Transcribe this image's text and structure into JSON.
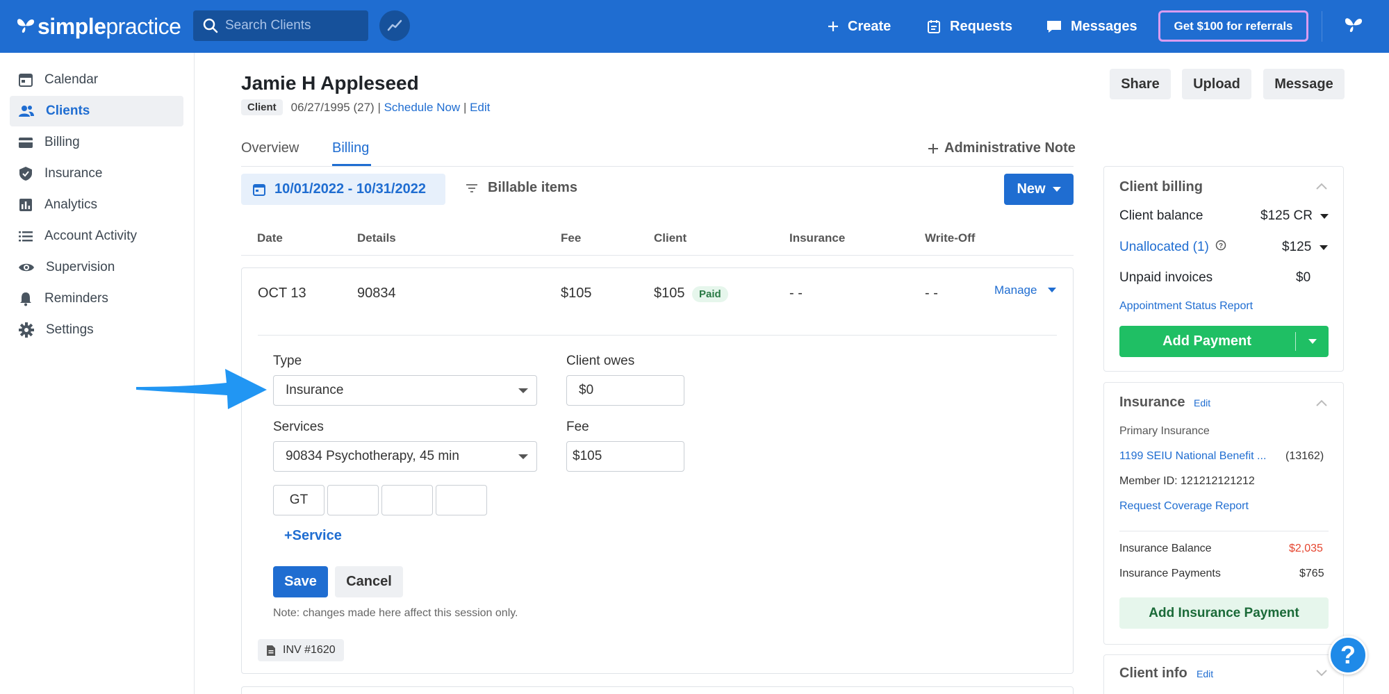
{
  "app": {
    "logo_bold": "simple",
    "logo_light": "practice",
    "search_placeholder": "Search Clients",
    "create": "Create",
    "requests": "Requests",
    "messages": "Messages",
    "referral": "Get $100 for referrals"
  },
  "sidebar": {
    "items": [
      {
        "label": "Calendar",
        "icon": "calendar-icon"
      },
      {
        "label": "Clients",
        "icon": "users-icon",
        "active": true
      },
      {
        "label": "Billing",
        "icon": "credit-card-icon"
      },
      {
        "label": "Insurance",
        "icon": "shield-icon"
      },
      {
        "label": "Analytics",
        "icon": "bar-chart-icon"
      },
      {
        "label": "Account Activity",
        "icon": "list-icon"
      },
      {
        "label": "Supervision",
        "icon": "eye-icon"
      },
      {
        "label": "Reminders",
        "icon": "bell-icon"
      },
      {
        "label": "Settings",
        "icon": "gear-icon"
      }
    ]
  },
  "client": {
    "name": "Jamie H Appleseed",
    "badge": "Client",
    "dob": "06/27/1995 (27)",
    "schedule": "Schedule Now",
    "edit": "Edit"
  },
  "header_buttons": {
    "share": "Share",
    "upload": "Upload",
    "message": "Message"
  },
  "tabs": {
    "overview": "Overview",
    "billing": "Billing",
    "admin_note": "Administrative Note"
  },
  "filters": {
    "date_range": "10/01/2022 - 10/31/2022",
    "billable": "Billable items",
    "new": "New"
  },
  "table": {
    "headers": [
      "Date",
      "Details",
      "Fee",
      "Client",
      "Insurance",
      "Write-Off"
    ],
    "row": {
      "date": "OCT 13",
      "details": "90834",
      "fee": "$105",
      "client": "$105",
      "status": "Paid",
      "insurance": "- -",
      "writeoff": "- -",
      "manage": "Manage"
    }
  },
  "edit_form": {
    "type_label": "Type",
    "type_value": "Insurance",
    "client_owes_label": "Client owes",
    "client_owes_value": "$0",
    "services_label": "Services",
    "services_value": "90834 Psychotherapy, 45 min",
    "fee_label": "Fee",
    "fee_value": "$105",
    "modifiers": [
      "GT",
      "",
      "",
      ""
    ],
    "add_service": "+Service",
    "save": "Save",
    "cancel": "Cancel",
    "note": "Note: changes made here affect this session only.",
    "invoice": "INV #1620"
  },
  "client_billing": {
    "title": "Client billing",
    "balance_label": "Client balance",
    "balance_value": "$125 CR",
    "unallocated_label": "Unallocated (1)",
    "unallocated_value": "$125",
    "unpaid_label": "Unpaid invoices",
    "unpaid_value": "$0",
    "report_link": "Appointment Status Report",
    "add_payment": "Add Payment"
  },
  "insurance": {
    "title": "Insurance",
    "edit": "Edit",
    "primary_label": "Primary Insurance",
    "payer": "1199 SEIU National Benefit ...",
    "payer_id": "(13162)",
    "member_id": "Member ID: 121212121212",
    "coverage_link": "Request Coverage Report",
    "balance_label": "Insurance Balance",
    "balance_value": "$2,035",
    "payments_label": "Insurance Payments",
    "payments_value": "$765",
    "add_payment": "Add Insurance Payment",
    "balance_color": "#e5452f"
  },
  "client_info": {
    "title": "Client info",
    "edit": "Edit"
  },
  "help": "?",
  "colors": {
    "brand": "#1f6dd1",
    "success": "#1fbf64"
  }
}
